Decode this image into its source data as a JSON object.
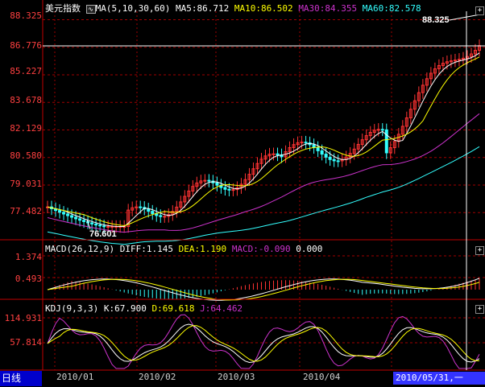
{
  "main": {
    "title": "美元指数",
    "ma_label": "MA(5,10,30,60)",
    "ma5": "MA5:86.712",
    "ma10": "MA10:86.502",
    "ma30": "MA30:84.355",
    "ma60": "MA60:82.578",
    "y_ticks": [
      "88.325",
      "86.776",
      "85.227",
      "83.678",
      "82.129",
      "80.580",
      "79.031",
      "77.482"
    ],
    "high_label": "88.325",
    "low_label": "76.601"
  },
  "macd": {
    "label": "MACD(26,12,9)",
    "diff": "DIFF:1.145",
    "dea": "DEA:1.190",
    "macd": "MACD:-0.090",
    "zero": "0.000",
    "y_ticks": [
      "1.374",
      "0.493"
    ]
  },
  "kdj": {
    "label": "KDJ(9,3,3)",
    "k": "K:67.900",
    "d": "D:69.618",
    "j": "J:64.462",
    "y_ticks": [
      "114.931",
      "57.814"
    ]
  },
  "x_axis": [
    "2010/01",
    "2010/02",
    "2010/03",
    "2010/04"
  ],
  "footer": {
    "period": "日线",
    "cursor_date": "2010/05/31,一"
  },
  "colors": {
    "ma5": "#ffffff",
    "ma10": "#ffff00",
    "ma30": "#cc33cc",
    "ma60": "#33ffff",
    "up": "#ff3333",
    "down": "#33ffff",
    "grid": "#a00000"
  },
  "icons": [
    "ma-toggle-icon",
    "expand-plus-icon"
  ]
}
